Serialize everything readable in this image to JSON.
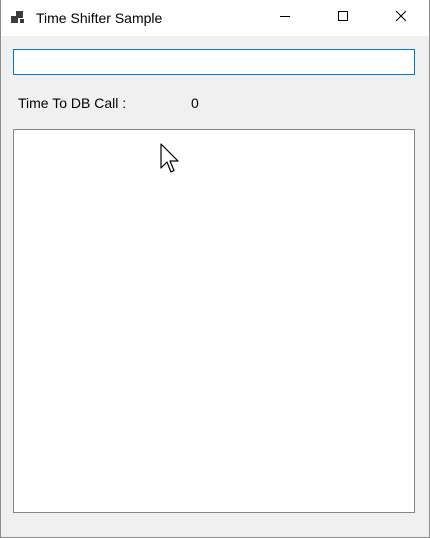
{
  "window": {
    "title": "Time Shifter Sample",
    "icons": {
      "app": "app-icon",
      "minimize": "minimize-icon",
      "maximize": "maximize-icon",
      "close": "close-icon"
    }
  },
  "form": {
    "input": {
      "value": "",
      "placeholder": ""
    },
    "db_call_label": "Time To DB Call :",
    "db_call_value": "0",
    "list_items": []
  },
  "colors": {
    "title_bar": "#ffffff",
    "window_bg": "#f0f0f0",
    "input_border_focus": "#0078d7",
    "list_border": "#828790"
  }
}
